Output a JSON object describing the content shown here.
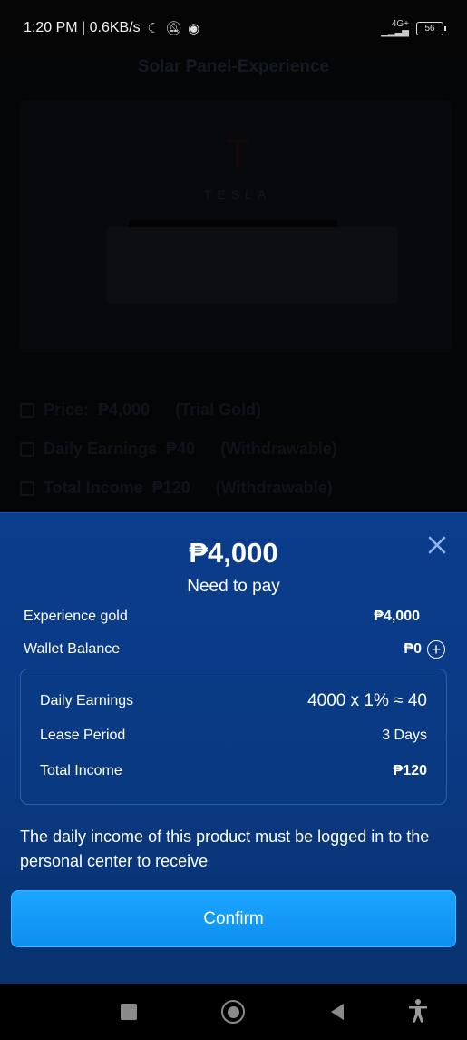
{
  "status_bar": {
    "time_speed": "1:20 PM | 0.6KB/s",
    "network": "4G+",
    "battery": "56"
  },
  "background_page": {
    "title": "Solar Panel-Experience",
    "brand": "TESLA",
    "rows": [
      {
        "label": "Price:",
        "value": "₱4,000",
        "note": "(Trial Gold)"
      },
      {
        "label": "Daily Earnings",
        "value": "₱40",
        "note": "(Withdrawable)"
      },
      {
        "label": "Total Income",
        "value": "₱120",
        "note": "(Withdrawable)"
      }
    ]
  },
  "sheet": {
    "amount": "₱4,000",
    "subtitle": "Need to pay",
    "experience_gold_label": "Experience gold",
    "experience_gold_value": "₱4,000",
    "wallet_label": "Wallet Balance",
    "wallet_value": "₱0",
    "details": {
      "daily_earnings_label": "Daily Earnings",
      "daily_earnings_value": "4000 x 1% ≈ 40",
      "lease_period_label": "Lease Period",
      "lease_period_value": "3 Days",
      "total_income_label": "Total Income",
      "total_income_value": "₱120"
    },
    "note": "The daily income of this product must be logged in to the personal center to receive",
    "confirm_label": "Confirm"
  },
  "colors": {
    "sheet_bg": "#0a3d8c",
    "confirm_bg": "#1aa6ff"
  }
}
